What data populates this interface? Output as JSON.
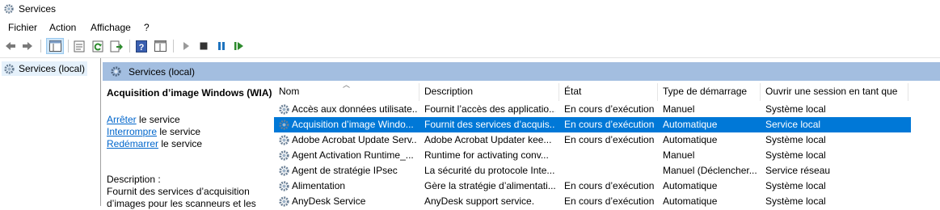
{
  "window": {
    "title": "Services"
  },
  "menu": [
    "Fichier",
    "Action",
    "Affichage",
    "?"
  ],
  "toolbar": {
    "buttons": [
      "back-icon",
      "forward-icon",
      "show-hide-tree-icon",
      "properties-icon",
      "refresh-icon",
      "export-icon",
      "help-icon",
      "view-icon",
      "start-icon",
      "stop-icon",
      "pause-icon",
      "resume-icon"
    ]
  },
  "tree": {
    "selected": "Services (local)"
  },
  "pane": {
    "title": "Services (local)"
  },
  "details": {
    "service_name": "Acquisition d’image Windows (WIA)",
    "actions": [
      {
        "link": "Arrêter",
        "rest": " le service"
      },
      {
        "link": "Interrompre",
        "rest": " le service"
      },
      {
        "link": "Redémarrer",
        "rest": " le service"
      }
    ],
    "description_label": "Description :",
    "description_text": "Fournit des services d’acquisition d’images pour les scanneurs et les"
  },
  "table": {
    "columns": [
      "Nom",
      "Description",
      "État",
      "Type de démarrage",
      "Ouvrir une session en tant que"
    ],
    "rows": [
      [
        "Accès aux données utilisate...",
        "Fournit l’accès des applicatio...",
        "En cours d’exécution",
        "Manuel",
        "Système local"
      ],
      [
        "Acquisition d’image Windo...",
        "Fournit des services d’acquis...",
        "En cours d’exécution",
        "Automatique",
        "Service local"
      ],
      [
        "Adobe Acrobat Update Serv...",
        "Adobe Acrobat Updater kee...",
        "En cours d’exécution",
        "Automatique",
        "Système local"
      ],
      [
        "Agent Activation Runtime_...",
        "Runtime for activating conv...",
        "",
        "Manuel",
        "Système local"
      ],
      [
        "Agent de stratégie IPsec",
        "La sécurité du protocole Inte...",
        "",
        "Manuel (Déclencher...",
        "Service réseau"
      ],
      [
        "Alimentation",
        "Gère la stratégie d’alimentati...",
        "En cours d’exécution",
        "Automatique",
        "Système local"
      ],
      [
        "AnyDesk Service",
        "AnyDesk support service.",
        "En cours d’exécution",
        "Automatique",
        "Système local"
      ]
    ],
    "selected_row": 1
  },
  "colors": {
    "selection": "#0078d7",
    "header": "#a3bee0",
    "link": "#0066cc"
  }
}
